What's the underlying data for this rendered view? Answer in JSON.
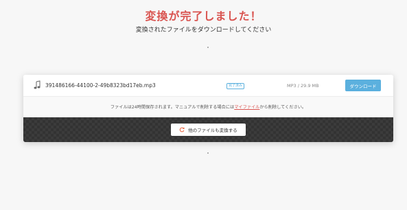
{
  "header": {
    "title": "変換が完了しました！",
    "subtitle": "変換されたファイルをダウンロードしてください"
  },
  "file": {
    "name": "391486166-44100-2-49b8323bd17eb.mp3",
    "status": "完了済み",
    "meta": "MP3 / 29.9 MB",
    "download_label": "ダウンロード",
    "icon": "music-note-icon"
  },
  "notice": {
    "before_link": "ファイルは24時間保存されます。マニュアルで削除する場合には",
    "link_text": "マイファイル",
    "after_link": "から削除してください。"
  },
  "convert": {
    "label": "他のファイルも変換する",
    "icon": "refresh-icon"
  },
  "colors": {
    "title_red": "#d9534f",
    "accent_blue": "#5bb0de",
    "dark_panel": "#333333"
  }
}
